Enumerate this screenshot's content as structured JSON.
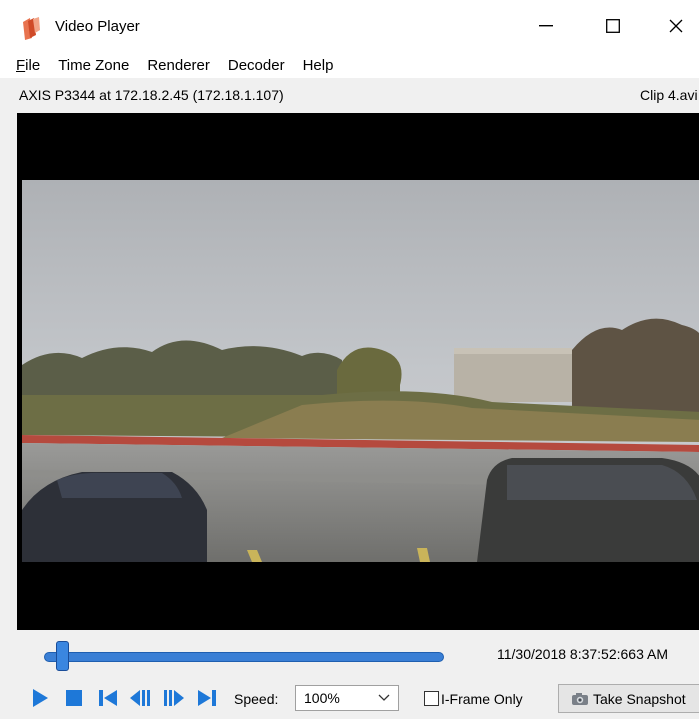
{
  "window": {
    "title": "Video Player",
    "icon": "video-player-app-icon"
  },
  "menu": {
    "items": [
      {
        "mnemonic": "F",
        "rest": "ile"
      },
      {
        "mnemonic": "",
        "rest": "Time Zone"
      },
      {
        "mnemonic": "",
        "rest": "Renderer"
      },
      {
        "mnemonic": "",
        "rest": "Decoder"
      },
      {
        "mnemonic": "",
        "rest": "Help"
      }
    ]
  },
  "info": {
    "camera": "AXIS P3344 at 172.18.2.45 (172.18.1.107)",
    "clip": "Clip 4.avi"
  },
  "timeline": {
    "timestamp": "11/30/2018 8:37:52:663 AM",
    "position_fraction": 0.03
  },
  "controls": {
    "speed_label": "Speed:",
    "speed_value": "100%",
    "iframe_label": "I-Frame Only",
    "iframe_checked": false,
    "snapshot_label": "Take Snapshot"
  },
  "colors": {
    "accent": "#1e78d8",
    "video_bg": "#000000"
  }
}
